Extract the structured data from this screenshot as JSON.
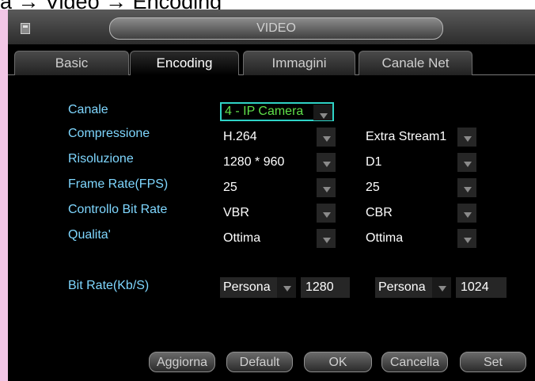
{
  "breadcrumb": "a → Video → Encoding",
  "window": {
    "title": "VIDEO"
  },
  "tabs": [
    {
      "label": "Basic"
    },
    {
      "label": "Encoding"
    },
    {
      "label": "Immagini"
    },
    {
      "label": "Canale Net"
    }
  ],
  "form": {
    "canale": {
      "label": "Canale",
      "value": "4 - IP Camera"
    },
    "compressione": {
      "label": "Compressione",
      "main": "H.264",
      "extra": "Extra Stream1"
    },
    "risoluzione": {
      "label": "Risoluzione",
      "main": "1280 * 960",
      "extra": "D1"
    },
    "frame_rate": {
      "label": "Frame Rate(FPS)",
      "main": "25",
      "extra": "25"
    },
    "bit_rate_control": {
      "label": "Controllo Bit Rate",
      "main": "VBR",
      "extra": "CBR"
    },
    "qualita": {
      "label": "Qualita'",
      "main": "Ottima",
      "extra": "Ottima"
    },
    "bit_rate": {
      "label": "Bit Rate(Kb/S)",
      "main_mode": "Persona",
      "main_value": "1280",
      "extra_mode": "Persona",
      "extra_value": "1024"
    }
  },
  "buttons": {
    "aggiorna": "Aggiorna",
    "default": "Default",
    "ok": "OK",
    "cancella": "Cancella",
    "set": "Set"
  },
  "colors": {
    "label": "#7fd7ff",
    "highlight_border": "#2fd3c6",
    "highlight_text": "#5fe04a",
    "background": "#000000",
    "side_strip": "#f2c6e6"
  }
}
